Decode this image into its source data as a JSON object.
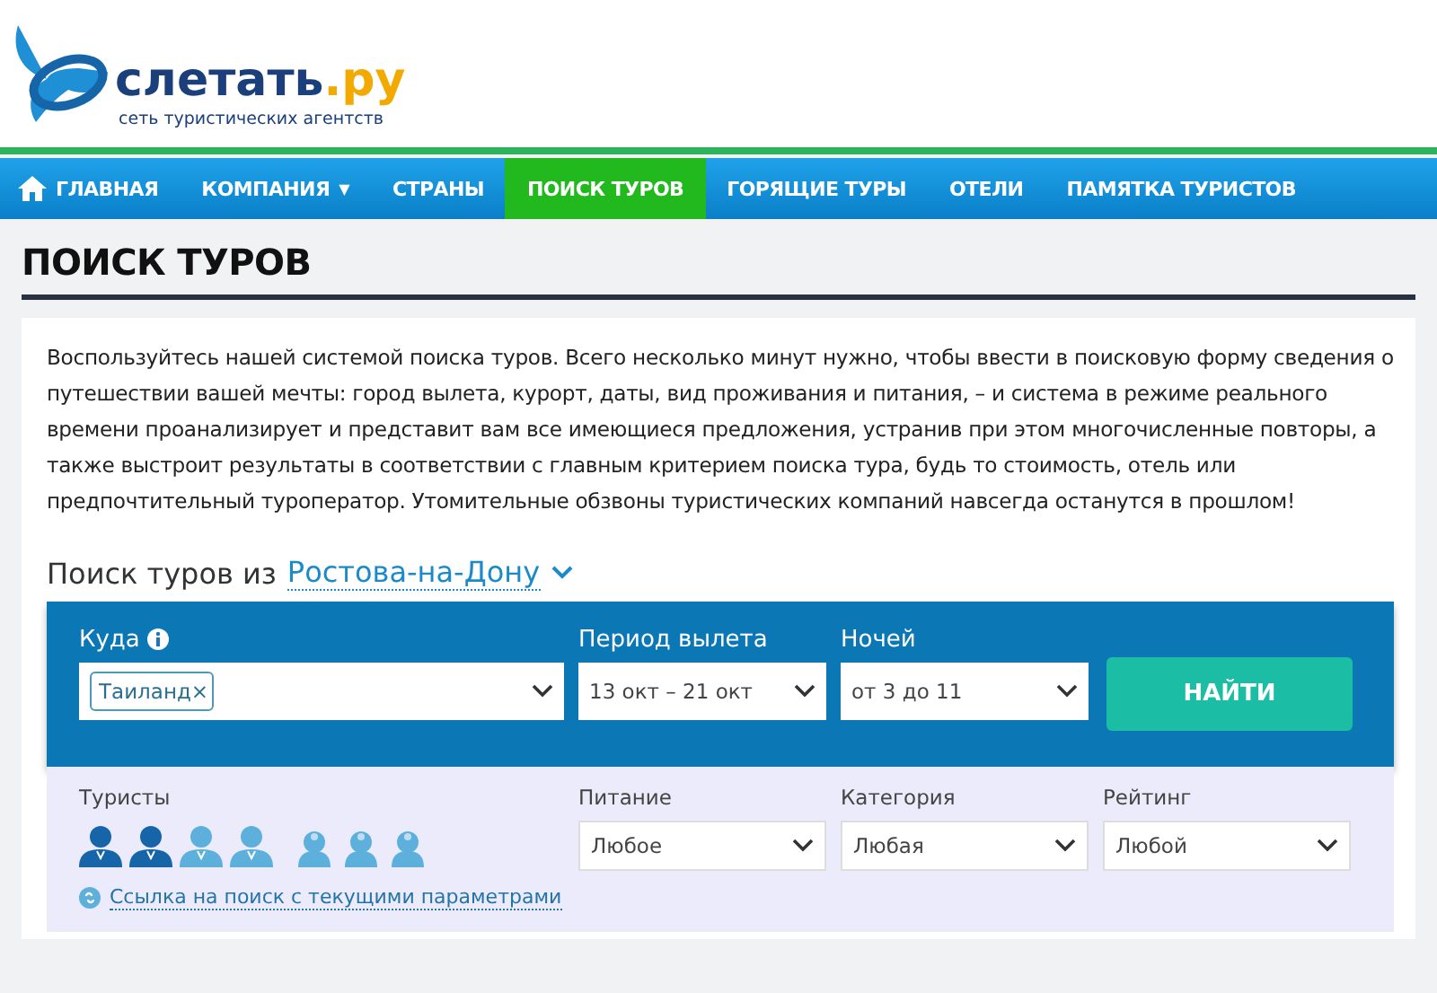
{
  "logo": {
    "name": "слетать",
    "domain": ".ру",
    "tagline": "сеть туристических агентств"
  },
  "nav": [
    {
      "label": "ГЛАВНАЯ",
      "kind": "home",
      "selected": false
    },
    {
      "label": "КОМПАНИЯ",
      "kind": "dropdown",
      "caret": "▼",
      "selected": false
    },
    {
      "label": "СТРАНЫ",
      "kind": "plain",
      "selected": false
    },
    {
      "label": "ПОИСК ТУРОВ",
      "kind": "plain",
      "selected": true
    },
    {
      "label": "ГОРЯЩИЕ ТУРЫ",
      "kind": "plain",
      "selected": false
    },
    {
      "label": "ОТЕЛИ",
      "kind": "plain",
      "selected": false
    },
    {
      "label": "ПАМЯТКА ТУРИСТОВ",
      "kind": "plain",
      "selected": false
    }
  ],
  "page_title": "ПОИСК ТУРОВ",
  "intro": "Воспользуйтесь нашей системой поиска туров. Всего несколько минут нужно, чтобы ввести в поисковую форму сведения о путешествии вашей мечты: город вылета, курорт, даты, вид проживания и питания, – и система в режиме реального времени проанализирует и представит вам все имеющиеся предложения, устранив при этом многочисленные повторы, а также выстроит результаты в соответствии с главным критерием поиска тура, будь то стоимость, отель или предпочтительный туроператор. Утомительные обзвоны туристических компаний навсегда останутся в прошлом!",
  "search": {
    "heading": "Поиск туров из",
    "city": "Ростова-на-Дону",
    "destination": {
      "label": "Куда",
      "tag": "Таиланд",
      "tag_remove": "×"
    },
    "period": {
      "label": "Период вылета",
      "value": "13 окт – 21 окт"
    },
    "nights": {
      "label": "Ночей",
      "value": "от 3 до 11"
    },
    "submit": "НАЙТИ",
    "tourists": {
      "label": "Туристы",
      "adults": [
        {
          "selected": true
        },
        {
          "selected": true
        },
        {
          "selected": false
        },
        {
          "selected": false
        }
      ],
      "children": [
        {
          "selected": false
        },
        {
          "selected": false
        },
        {
          "selected": false
        }
      ]
    },
    "filters": [
      {
        "label": "Питание",
        "value": "Любое"
      },
      {
        "label": "Категория",
        "value": "Любая"
      },
      {
        "label": "Рейтинг",
        "value": "Любой"
      }
    ],
    "link": "Ссылка на поиск с текущими параметрами"
  }
}
